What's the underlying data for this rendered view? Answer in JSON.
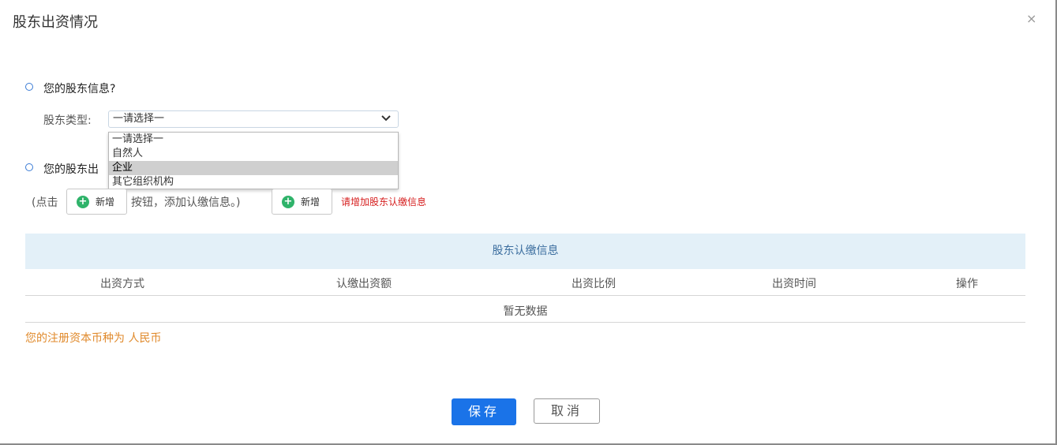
{
  "dialog": {
    "title": "股东出资情况",
    "close_symbol": "×"
  },
  "question1": {
    "text": "您的股东信息?",
    "field_label": "股东类型:",
    "select_value": "一请选择一",
    "options": [
      "一请选择一",
      "自然人",
      "企业",
      "其它组织机构"
    ],
    "highlighted_option": "企业"
  },
  "question2": {
    "text": "您的股东出"
  },
  "hint": {
    "prefix": "(点击",
    "middle": "按钮，添加认缴信息。)",
    "add_label": "新增",
    "add_label_2": "新增",
    "warning": "请增加股东认缴信息"
  },
  "table": {
    "title": "股东认缴信息",
    "columns": [
      "出资方式",
      "认缴出资额",
      "出资比例",
      "出资时间",
      "操作"
    ],
    "empty_text": "暂无数据"
  },
  "currency_note": "您的注册资本币种为 人民币",
  "footer": {
    "save_label": "保存",
    "cancel_label": "取消"
  }
}
